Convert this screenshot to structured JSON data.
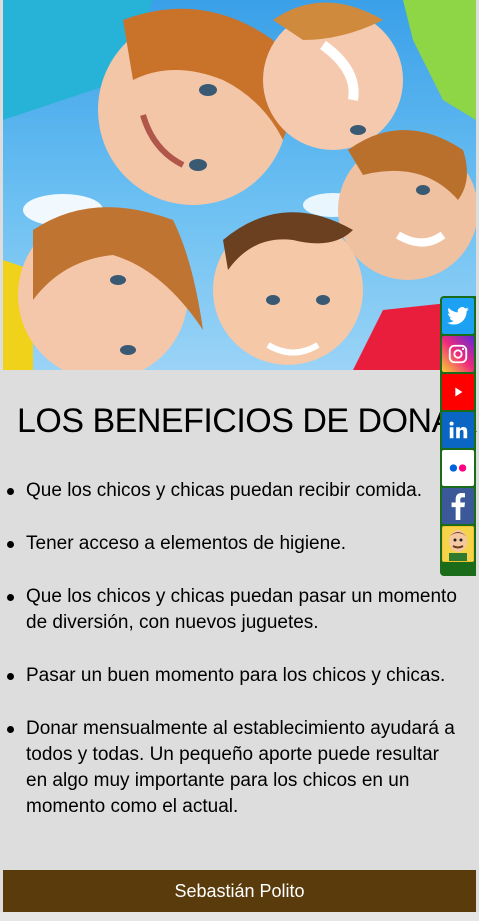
{
  "main": {
    "title": "LOS BENEFICIOS DE DONAR",
    "benefits": [
      "Que los chicos y chicas puedan recibir comida.",
      "Tener acceso a elementos de higiene.",
      "Que los chicos y chicas puedan pasar un momento de diversión, con nuevos juguetes.",
      "Pasar un buen momento para los chicos y chicas.",
      "Donar mensualmente al establecimiento ayudará a todos y todas. Un pequeño aporte puede resultar en algo muy importante para los chicos en un momento como el actual."
    ]
  },
  "footer": {
    "author": "Sebastián Polito"
  },
  "social": [
    {
      "icon": "twitter-icon",
      "color": "#1da1f2"
    },
    {
      "icon": "instagram-icon",
      "color": "#c13584"
    },
    {
      "icon": "youtube-icon",
      "color": "#ff0000"
    },
    {
      "icon": "linkedin-icon",
      "color": "#0a66c2"
    },
    {
      "icon": "flickr-icon",
      "color": "#ffffff"
    },
    {
      "icon": "facebook-icon",
      "color": "#3b5998"
    },
    {
      "icon": "avatar-icon",
      "color": "#f2c230"
    }
  ]
}
